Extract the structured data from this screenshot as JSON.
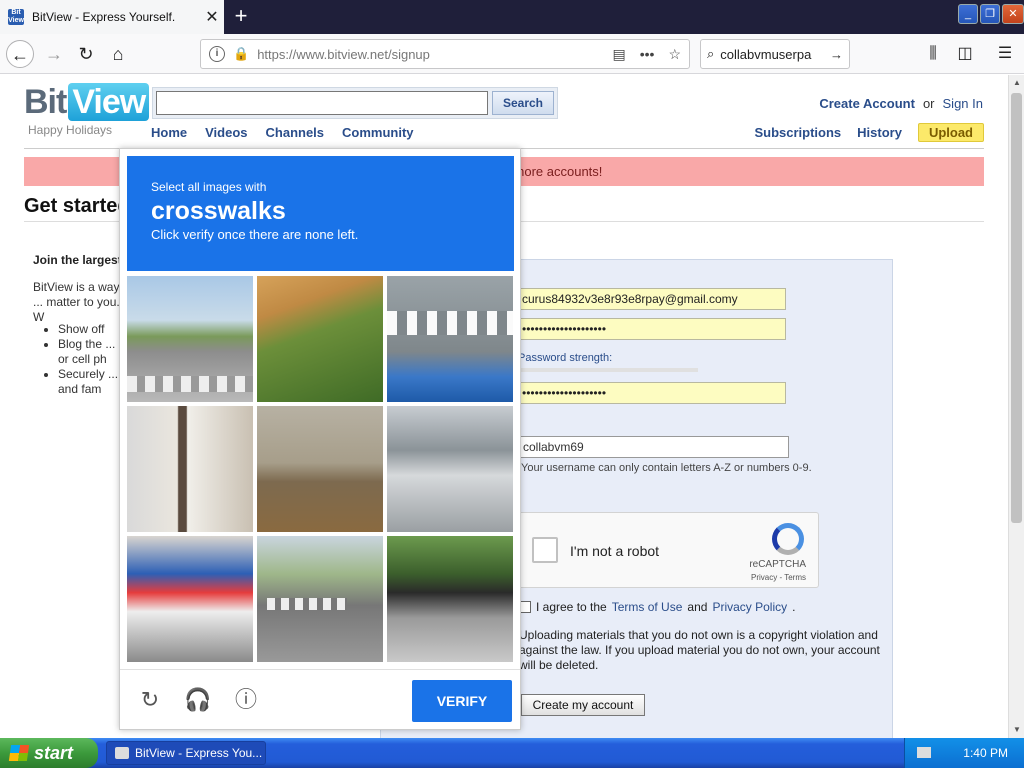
{
  "browser": {
    "tab_title": "BitView - Express Yourself.",
    "favicon_text": "Bit View",
    "url_host": "https://www.bitview.net",
    "url_path": "/signup",
    "search_value": "collabvmuserpa"
  },
  "site": {
    "logo_bit": "Bit",
    "logo_view": "View",
    "tagline": "Happy Holidays",
    "search_button": "Search",
    "nav": [
      "Home",
      "Videos",
      "Channels",
      "Community"
    ],
    "create_account": "Create Account",
    "or": "or",
    "sign_in": "Sign In",
    "subscriptions": "Subscriptions",
    "history": "History",
    "upload": "Upload",
    "alert": "You cannot create more accounts!",
    "heading": "Get started",
    "join_text": "Join the largest",
    "lead_text": "BitView is a way ... matter to you. W",
    "bullets": [
      "Show off",
      "Blog the ... or cell ph",
      "Securely ... and fam"
    ]
  },
  "form": {
    "email_value": "curus84932v3e8r93e8rpay@gmail.comy",
    "password_dots": "••••••••••••••••••••",
    "password_strength_label": "Password strength:",
    "confirm_dots": "••••••••••••••••••••",
    "username_value": "collabvm69",
    "username_hint": "Your username can only contain letters A-Z or numbers 0-9.",
    "recaptcha_label": "I'm not a robot",
    "recaptcha_brand": "reCAPTCHA",
    "recaptcha_terms": "Privacy - Terms",
    "agree_prefix": "I agree to the",
    "terms_link": "Terms of Use",
    "and": "and",
    "privacy_link": "Privacy Policy",
    "agree_suffix": ".",
    "warning": "Uploading materials that you do not own is a copyright violation and against the law. If you upload material you do not own, your account will be deleted.",
    "create_button": "Create my account"
  },
  "challenge": {
    "line1": "Select all images with",
    "keyword": "crosswalks",
    "line3": "Click verify once there are none left.",
    "verify_button": "VERIFY",
    "tiles": [
      "street-intersection",
      "garden-arch",
      "crosswalk-road",
      "house-facade",
      "bags-on-sidewalk",
      "parked-car",
      "shop-storefront",
      "road-markings",
      "parked-cars-street"
    ]
  },
  "taskbar": {
    "start": "start",
    "task_title": "BitView - Express You...",
    "clock": "1:40 PM"
  }
}
